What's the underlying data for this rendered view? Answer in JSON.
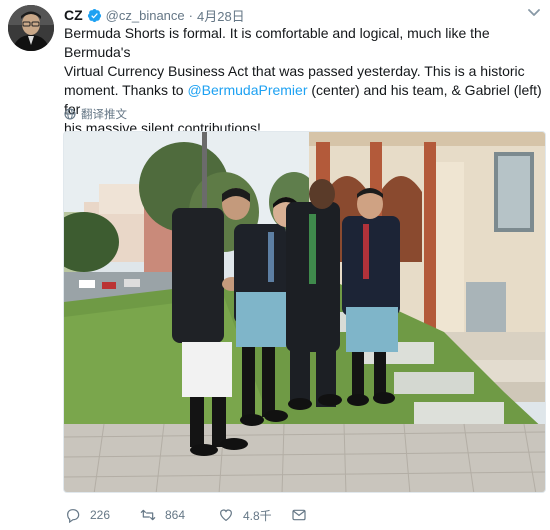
{
  "tweet": {
    "author_name": "CZ",
    "handle": "@cz_binance",
    "separator": "·",
    "timestamp": "4月28日",
    "text_line1": "Bermuda Shorts is formal. It is comfortable and logical, much like the Bermuda's",
    "text_line2": "Virtual Currency Business Act that was passed yesterday. This is a historic",
    "text_line3_a": "moment. Thanks to ",
    "mention": "@BermudaPremier",
    "text_line3_b": " (center) and his team, & Gabriel (left) for",
    "text_line4": "his massive silent contributions!",
    "translate_label": "翻译推文",
    "photo_description": "photo",
    "counts": {
      "replies": "226",
      "retweets": "864",
      "likes": "4.8千"
    }
  },
  "colors": {
    "text": "#14171a",
    "secondary": "#657786",
    "link": "#1da1f2",
    "verified": "#1da1f2"
  },
  "icons": [
    "verified-badge-icon",
    "chevron-down-icon",
    "globe-icon",
    "reply-icon",
    "retweet-icon",
    "like-icon",
    "direct-message-icon"
  ]
}
